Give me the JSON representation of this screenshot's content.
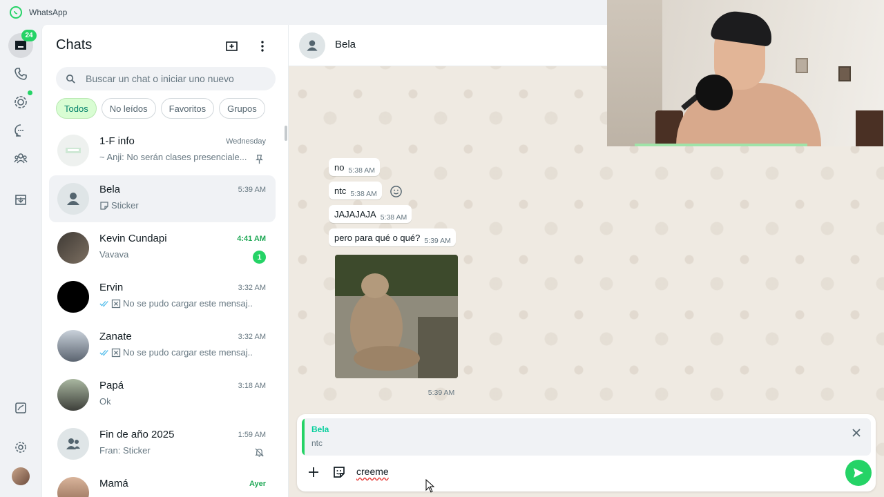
{
  "app": {
    "title": "WhatsApp"
  },
  "rail": {
    "chats_badge": "24"
  },
  "list": {
    "title": "Chats",
    "search_placeholder": "Buscar un chat o iniciar uno nuevo",
    "filters": [
      "Todos",
      "No leídos",
      "Favoritos",
      "Grupos"
    ],
    "chats": [
      {
        "name": "1-F info",
        "time": "Wednesday",
        "preview": "~ Anji: No serán clases presenciale...",
        "pinned": true
      },
      {
        "name": "Bela",
        "time": "5:39 AM",
        "preview": "Sticker",
        "selected": true
      },
      {
        "name": "Kevin Cundapi",
        "time": "4:41 AM",
        "preview": "Vavava",
        "unread": "1"
      },
      {
        "name": "Ervin",
        "time": "3:32 AM",
        "preview": "No se pudo cargar este mensaj..."
      },
      {
        "name": "Zanate",
        "time": "3:32 AM",
        "preview": "No se pudo cargar este mensaj..."
      },
      {
        "name": "Papá",
        "time": "3:18 AM",
        "preview": "Ok"
      },
      {
        "name": "Fin de año 2025",
        "time": "1:59 AM",
        "preview": "Fran: Sticker",
        "muted": true
      },
      {
        "name": "Mamá",
        "time": "Ayer",
        "preview": ""
      }
    ]
  },
  "conversation": {
    "contact_name": "Bela",
    "messages": [
      {
        "text": "no",
        "time": "5:38 AM"
      },
      {
        "text": "ntc",
        "time": "5:38 AM"
      },
      {
        "text": "JAJAJAJA",
        "time": "5:38 AM"
      },
      {
        "text": "pero para qué o qué?",
        "time": "5:39 AM"
      }
    ],
    "image_time": "5:39 AM"
  },
  "composer": {
    "reply_to_name": "Bela",
    "reply_to_text": "ntc",
    "input_value": "creeme"
  },
  "colors": {
    "accent": "#25d366",
    "chat_bg": "#efeae2",
    "selected_chip": "#d9fdd3"
  }
}
